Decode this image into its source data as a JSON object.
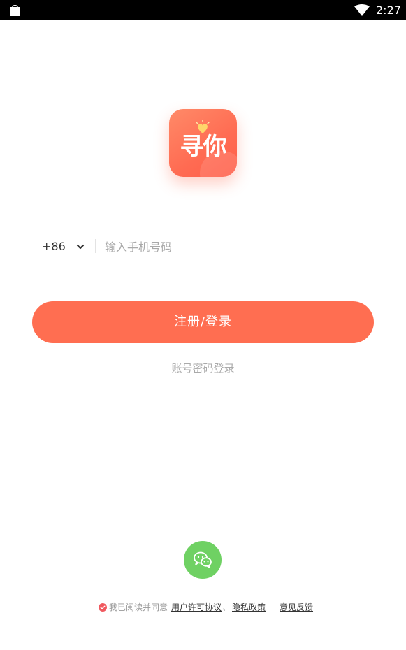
{
  "status_bar": {
    "time": "2:27",
    "left_icon": "shopping-bag-icon",
    "right_icon": "wifi-icon"
  },
  "logo": {
    "text": "寻你",
    "icon": "heart-icon",
    "accent_color": "#ff6e51"
  },
  "phone": {
    "country_code": "+86",
    "placeholder": "输入手机号码",
    "value": ""
  },
  "actions": {
    "register_login": "注册/登录",
    "password_login": "账号密码登录"
  },
  "wechat": {
    "icon": "wechat-icon",
    "color": "#6fd163"
  },
  "agreement": {
    "prefix": "我已阅读并同意",
    "terms": "用户许可协议",
    "separator": "、",
    "privacy": "隐私政策",
    "feedback": "意见反馈",
    "checked": true,
    "check_color": "#f0595f"
  }
}
